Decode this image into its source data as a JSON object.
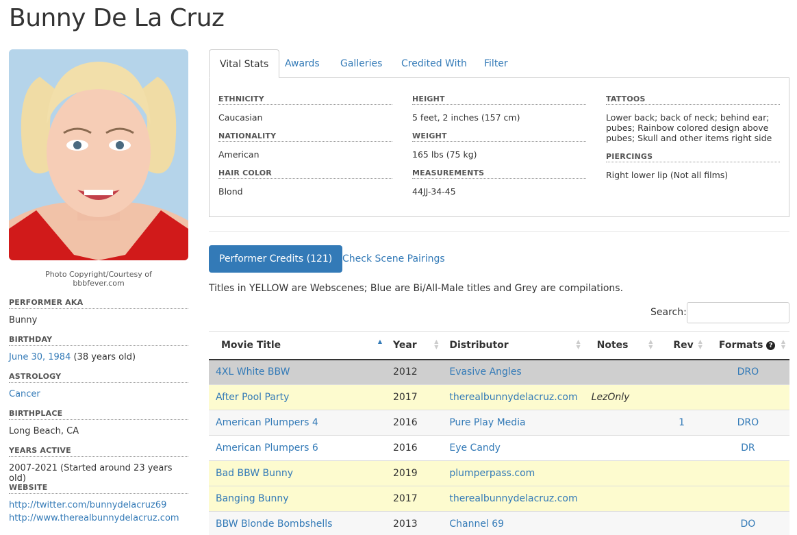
{
  "page": {
    "title": "Bunny De La Cruz"
  },
  "photo": {
    "credit_line1": "Photo Copyright/Courtesy of",
    "credit_line2": "bbbfever.com"
  },
  "aka": [
    {
      "label": "Performer AKA",
      "value": "Bunny"
    },
    {
      "label": "Birthday",
      "link": "June 30, 1984",
      "value": " (38 years old)"
    },
    {
      "label": "Astrology",
      "link": "Cancer"
    },
    {
      "label": "Birthplace",
      "value": "Long Beach, CA"
    },
    {
      "label": "Years Active",
      "value": "2007-2021 (Started around 23 years old)"
    },
    {
      "label": "Website",
      "links": [
        "http://twitter.com/bunnydelacruz69",
        "http://www.therealbunnydelacruz.com"
      ]
    }
  ],
  "tabs": [
    "Vital Stats",
    "Awards",
    "Galleries",
    "Credited With",
    "Filter"
  ],
  "vital_stats": {
    "col1": [
      {
        "label": "Ethnicity",
        "value": "Caucasian"
      },
      {
        "label": "Nationality",
        "value": "American"
      },
      {
        "label": "Hair Color",
        "value": "Blond"
      }
    ],
    "col2": [
      {
        "label": "Height",
        "value": "5 feet, 2 inches (157 cm)"
      },
      {
        "label": "Weight",
        "value": "165 lbs (75 kg)"
      },
      {
        "label": "Measurements",
        "value": "44JJ-34-45"
      }
    ],
    "col3": [
      {
        "label": "Tattoos",
        "value": "Lower back; back of neck; behind ear; pubes; Rainbow colored design above pubes; Skull and other items right side"
      },
      {
        "label": "Piercings",
        "value": "Right lower lip (Not all films)"
      }
    ]
  },
  "credits": {
    "button": "Performer Credits (121)",
    "pairings": "Check Scene Pairings",
    "legend": "Titles in YELLOW are Webscenes; Blue are Bi/All-Male titles and Grey are compilations.",
    "search_label": "Search:",
    "search_value": "",
    "columns": [
      "Movie Title",
      "Year",
      "Distributor",
      "Notes",
      "Rev",
      "Formats"
    ],
    "rows": [
      {
        "style": "grey",
        "title": "4XL White BBW",
        "year": "2012",
        "distributor": "Evasive Angles",
        "notes": "",
        "rev": "",
        "formats": "DRO"
      },
      {
        "style": "yellow",
        "title": "After Pool Party",
        "year": "2017",
        "distributor": "therealbunnydelacruz.com",
        "notes": "LezOnly",
        "rev": "",
        "formats": ""
      },
      {
        "style": "plain",
        "title": "American Plumpers 4",
        "year": "2016",
        "distributor": "Pure Play Media",
        "notes": "",
        "rev": "1",
        "formats": "DRO"
      },
      {
        "style": "white",
        "title": "American Plumpers 6",
        "year": "2016",
        "distributor": "Eye Candy",
        "notes": "",
        "rev": "",
        "formats": "DR"
      },
      {
        "style": "yellow",
        "title": "Bad BBW Bunny",
        "year": "2019",
        "distributor": "plumperpass.com",
        "notes": "",
        "rev": "",
        "formats": ""
      },
      {
        "style": "yellow",
        "title": "Banging Bunny",
        "year": "2017",
        "distributor": "therealbunnydelacruz.com",
        "notes": "",
        "rev": "",
        "formats": ""
      },
      {
        "style": "plain",
        "title": "BBW Blonde Bombshells",
        "year": "2013",
        "distributor": "Channel 69",
        "notes": "",
        "rev": "",
        "formats": "DO"
      }
    ]
  }
}
